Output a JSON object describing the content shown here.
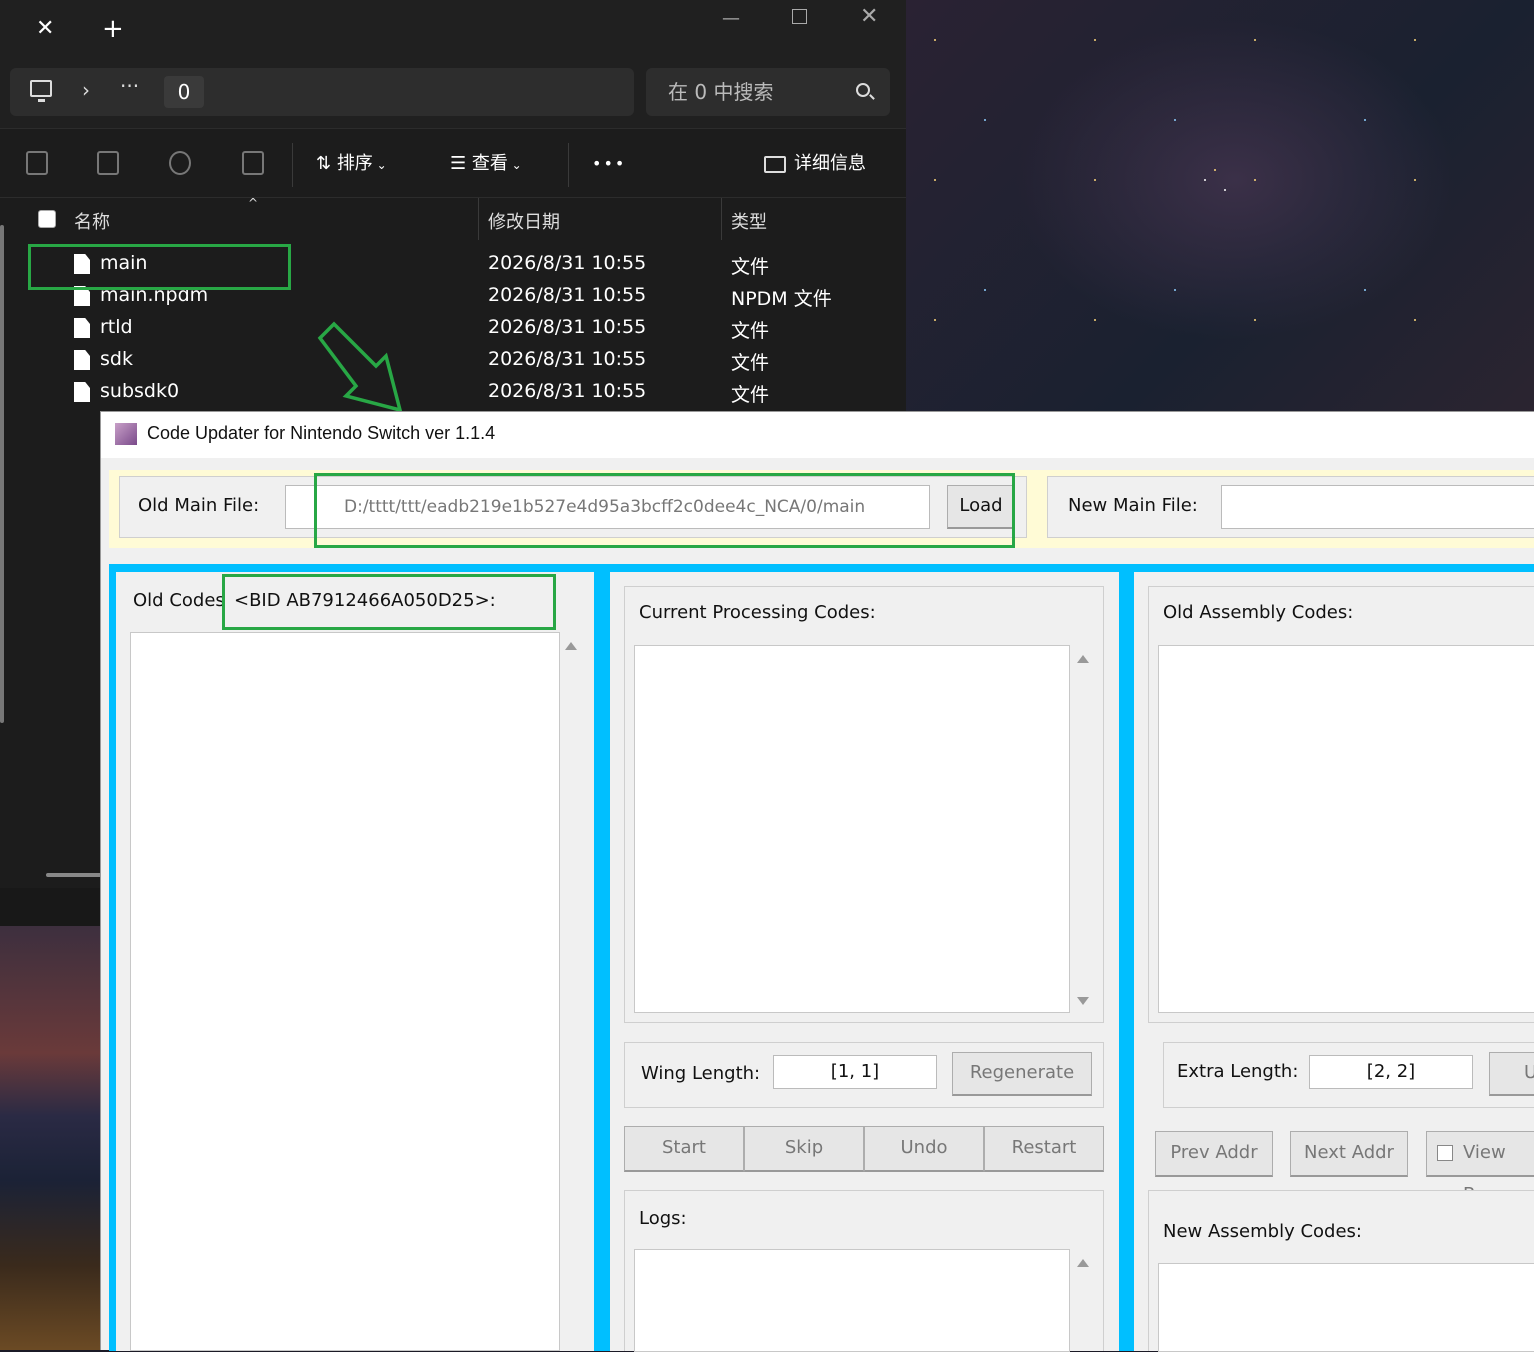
{
  "explorer": {
    "tab_close": "✕",
    "tab_add": "+",
    "window_controls": {
      "min": "—",
      "close": "✕"
    },
    "address": {
      "chevron": "›",
      "more": "···",
      "crumb": "0"
    },
    "search_placeholder": "在 0 中搜索",
    "toolbar": {
      "sort_label": "排序",
      "view_label": "查看",
      "more": "•••",
      "details_label": "详细信息"
    },
    "columns": {
      "name": "名称",
      "modified": "修改日期",
      "type": "类型"
    },
    "files": [
      {
        "name": "main",
        "date": "2026/8/31 10:55",
        "type": "文件"
      },
      {
        "name": "main.npdm",
        "date": "2026/8/31 10:55",
        "type": "NPDM 文件"
      },
      {
        "name": "rtld",
        "date": "2026/8/31 10:55",
        "type": "文件"
      },
      {
        "name": "sdk",
        "date": "2026/8/31 10:55",
        "type": "文件"
      },
      {
        "name": "subsdk0",
        "date": "2026/8/31 10:55",
        "type": "文件"
      }
    ]
  },
  "app": {
    "title": "Code Updater for Nintendo Switch ver 1.1.4",
    "old_main_file_label": "Old Main File:",
    "old_main_file_value": "D:/tttt/ttt/eadb219e1b527e4d95a3bcff2c0dee4c_NCA/0/main",
    "load_label": "Load",
    "new_main_file_label": "New Main File:",
    "old_codes_label": "Old Codes",
    "bid_label": "<BID AB7912466A050D25>:",
    "current_processing_label": "Current Processing Codes:",
    "old_assembly_label": "Old Assembly Codes:",
    "wing_length_label": "Wing Length:",
    "wing_length_value": "[1, 1]",
    "regenerate_label": "Regenerate",
    "extra_length_label": "Extra Length:",
    "extra_length_value": "[2, 2]",
    "extra_button_partial": "U",
    "start_label": "Start",
    "skip_label": "Skip",
    "undo_label": "Undo",
    "restart_label": "Restart",
    "prev_addr_label": "Prev Addr",
    "next_addr_label": "Next Addr",
    "view_branch_partial": "View Bra",
    "logs_label": "Logs:",
    "new_assembly_label": "New Assembly Codes:"
  },
  "colors": {
    "highlight": "#28a745",
    "panel_border": "#00bfff",
    "file_strip": "#fffbd6"
  }
}
